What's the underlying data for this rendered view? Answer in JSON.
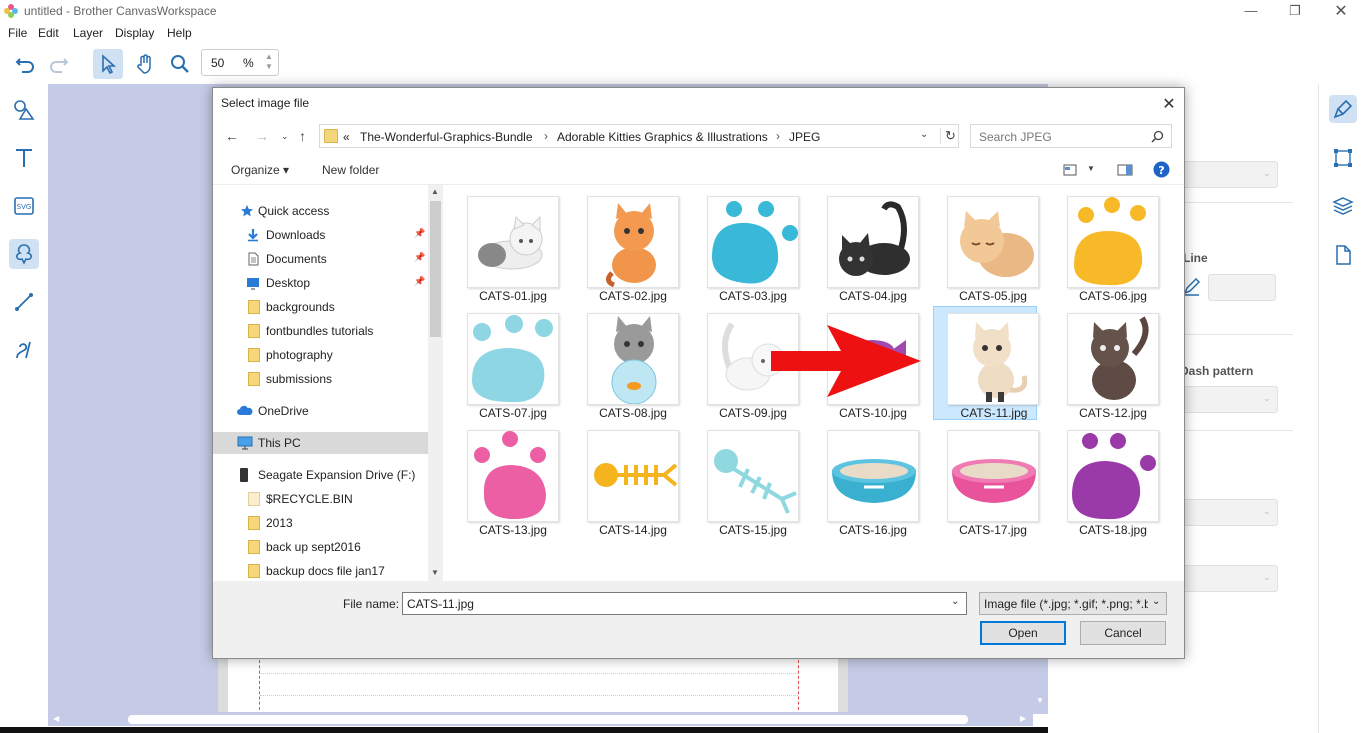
{
  "app": {
    "title": "untitled - Brother CanvasWorkspace",
    "window_controls": [
      "minimize-icon",
      "restore-icon",
      "close-icon"
    ]
  },
  "menu": [
    "File",
    "Edit",
    "Layer",
    "Display",
    "Help"
  ],
  "toolbar": {
    "zoom_value": "50",
    "zoom_unit": "%"
  },
  "right_panel": {
    "line_label": "Line",
    "dash_label": "Dash pattern"
  },
  "dialog": {
    "title": "Select image file",
    "breadcrumb": [
      "«",
      "The-Wonderful-Graphics-Bundle",
      "Adorable Kitties Graphics & Illustrations",
      "JPEG"
    ],
    "search_placeholder": "Search JPEG",
    "organize_label": "Organize ▾",
    "new_folder_label": "New folder",
    "nav_items": [
      {
        "label": "Quick access",
        "icon": "star-icon",
        "pinned": false
      },
      {
        "label": "Downloads",
        "icon": "download-icon",
        "pinned": true
      },
      {
        "label": "Documents",
        "icon": "document-icon",
        "pinned": true
      },
      {
        "label": "Desktop",
        "icon": "desktop-icon",
        "pinned": true
      },
      {
        "label": "backgrounds",
        "icon": "folder-icon",
        "pinned": false
      },
      {
        "label": "fontbundles tutorials",
        "icon": "folder-icon",
        "pinned": false
      },
      {
        "label": "photography",
        "icon": "folder-icon",
        "pinned": false
      },
      {
        "label": "submissions",
        "icon": "folder-icon",
        "pinned": false
      },
      {
        "label": "OneDrive",
        "icon": "cloud-icon",
        "pinned": false
      },
      {
        "label": "This PC",
        "icon": "computer-icon",
        "pinned": false,
        "selected": true
      },
      {
        "label": "Seagate Expansion Drive (F:)",
        "icon": "drive-icon",
        "pinned": false
      },
      {
        "label": "$RECYCLE.BIN",
        "icon": "folder-icon",
        "pinned": false
      },
      {
        "label": "2013",
        "icon": "folder-icon",
        "pinned": false
      },
      {
        "label": "back up sept2016",
        "icon": "folder-icon",
        "pinned": false
      },
      {
        "label": "backup docs file jan17",
        "icon": "folder-icon",
        "pinned": false
      }
    ],
    "files": [
      {
        "name": "CATS-01.jpg",
        "thumb": "white-cat-lying"
      },
      {
        "name": "CATS-02.jpg",
        "thumb": "orange-tabby-kitten"
      },
      {
        "name": "CATS-03.jpg",
        "thumb": "teal-paw"
      },
      {
        "name": "CATS-04.jpg",
        "thumb": "black-cat"
      },
      {
        "name": "CATS-05.jpg",
        "thumb": "beige-cat-sleeping"
      },
      {
        "name": "CATS-06.jpg",
        "thumb": "yellow-paw"
      },
      {
        "name": "CATS-07.jpg",
        "thumb": "light-blue-paw"
      },
      {
        "name": "CATS-08.jpg",
        "thumb": "grey-kitten-fishbowl"
      },
      {
        "name": "CATS-09.jpg",
        "thumb": "white-cat-walking"
      },
      {
        "name": "CATS-10.jpg",
        "thumb": "purple-fish"
      },
      {
        "name": "CATS-11.jpg",
        "thumb": "cream-kitten-sitting",
        "selected": true
      },
      {
        "name": "CATS-12.jpg",
        "thumb": "brown-cat"
      },
      {
        "name": "CATS-13.jpg",
        "thumb": "pink-paw"
      },
      {
        "name": "CATS-14.jpg",
        "thumb": "yellow-fishbone"
      },
      {
        "name": "CATS-15.jpg",
        "thumb": "light-blue-fishbone"
      },
      {
        "name": "CATS-16.jpg",
        "thumb": "blue-bowl"
      },
      {
        "name": "CATS-17.jpg",
        "thumb": "pink-bowl"
      },
      {
        "name": "CATS-18.jpg",
        "thumb": "purple-paw"
      }
    ],
    "filename_label": "File name:",
    "filename_value": "CATS-11.jpg",
    "filetype_value": "Image file (*.jpg; *.gif; *.png; *.b",
    "open_label": "Open",
    "cancel_label": "Cancel"
  },
  "colors": {
    "selection": "#cce8ff",
    "accent": "#0078d7",
    "canvas_bg": "#c5cbe6",
    "annotation_arrow": "#ee1111"
  }
}
